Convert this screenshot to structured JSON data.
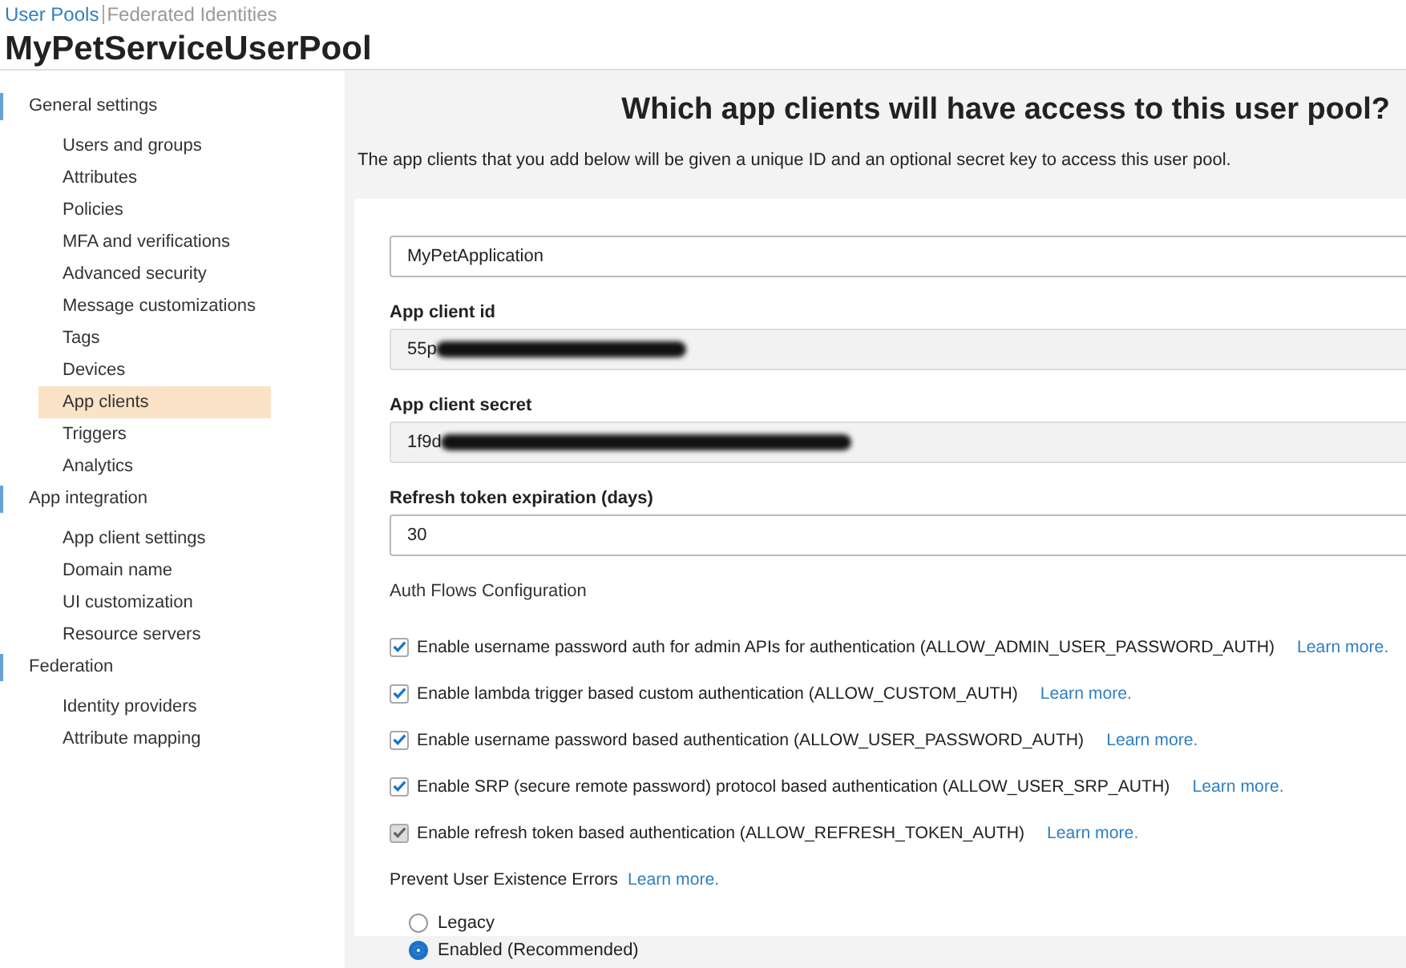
{
  "header": {
    "tabs": [
      {
        "label": "User Pools",
        "selected": true
      },
      {
        "label": "Federated Identities",
        "selected": false
      }
    ],
    "title": "MyPetServiceUserPool"
  },
  "sidebar": {
    "groups": [
      {
        "label": "General settings",
        "items": [
          {
            "label": "Users and groups",
            "selected": false
          },
          {
            "label": "Attributes",
            "selected": false
          },
          {
            "label": "Policies",
            "selected": false
          },
          {
            "label": "MFA and verifications",
            "selected": false
          },
          {
            "label": "Advanced security",
            "selected": false
          },
          {
            "label": "Message customizations",
            "selected": false
          },
          {
            "label": "Tags",
            "selected": false
          },
          {
            "label": "Devices",
            "selected": false
          },
          {
            "label": "App clients",
            "selected": true
          },
          {
            "label": "Triggers",
            "selected": false
          },
          {
            "label": "Analytics",
            "selected": false
          }
        ]
      },
      {
        "label": "App integration",
        "items": [
          {
            "label": "App client settings",
            "selected": false
          },
          {
            "label": "Domain name",
            "selected": false
          },
          {
            "label": "UI customization",
            "selected": false
          },
          {
            "label": "Resource servers",
            "selected": false
          }
        ]
      },
      {
        "label": "Federation",
        "items": [
          {
            "label": "Identity providers",
            "selected": false
          },
          {
            "label": "Attribute mapping",
            "selected": false
          }
        ]
      }
    ]
  },
  "main": {
    "heading": "Which app clients will have access to this user pool?",
    "description": "The app clients that you add below will be given a unique ID and an optional secret key to access this user pool.",
    "fields": [
      {
        "value": "MyPetApplication",
        "readonly": false,
        "redacted": false
      },
      {
        "label": "App client id",
        "value": "55p",
        "readonly": true,
        "redacted": true
      },
      {
        "label": "App client secret",
        "value": "1f9d",
        "readonly": true,
        "redacted": true
      },
      {
        "label": "Refresh token expiration (days)",
        "value": "30",
        "readonly": false,
        "redacted": false
      }
    ],
    "auth_flows": {
      "title": "Auth Flows Configuration",
      "options": [
        {
          "label": "Enable username password auth for admin APIs for authentication (ALLOW_ADMIN_USER_PASSWORD_AUTH)",
          "link": "Learn more.",
          "checked": true,
          "disabled": false
        },
        {
          "label": "Enable lambda trigger based custom authentication (ALLOW_CUSTOM_AUTH)",
          "link": "Learn more.",
          "checked": true,
          "disabled": false
        },
        {
          "label": "Enable username password based authentication (ALLOW_USER_PASSWORD_AUTH)",
          "link": "Learn more.",
          "checked": true,
          "disabled": false
        },
        {
          "label": "Enable SRP (secure remote password) protocol based authentication (ALLOW_USER_SRP_AUTH)",
          "link": "Learn more.",
          "checked": true,
          "disabled": false
        },
        {
          "label": "Enable refresh token based authentication (ALLOW_REFRESH_TOKEN_AUTH)",
          "link": "Learn more.",
          "checked": true,
          "disabled": true
        }
      ]
    },
    "user_existence": {
      "title": "Prevent User Existence Errors",
      "link": "Learn more.",
      "options": [
        {
          "label": "Legacy",
          "selected": false
        },
        {
          "label": "Enabled (Recommended)",
          "selected": true
        }
      ]
    }
  }
}
